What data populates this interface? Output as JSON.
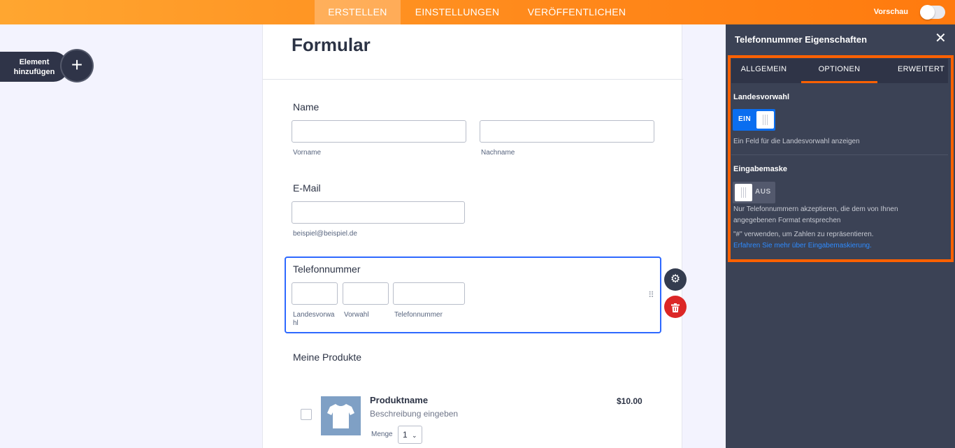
{
  "topbar": {
    "tabs": [
      {
        "label": "ERSTELLEN",
        "active": true
      },
      {
        "label": "EINSTELLUNGEN",
        "active": false
      },
      {
        "label": "VERÖFFENTLICHEN",
        "active": false
      }
    ],
    "preview_label": "Vorschau",
    "preview_on": false
  },
  "add_element": {
    "label_line1": "Element",
    "label_line2": "hinzufügen",
    "icon": "plus-icon"
  },
  "form": {
    "title": "Formular",
    "name": {
      "label": "Name",
      "first_sub": "Vorname",
      "last_sub": "Nachname",
      "first_value": "",
      "last_value": ""
    },
    "email": {
      "label": "E-Mail",
      "sub": "beispiel@beispiel.de",
      "value": ""
    },
    "phone": {
      "label": "Telefonnummer",
      "country_sub": "Landesvorwa hl",
      "area_sub": "Vorwahl",
      "number_sub": "Telefonnummer"
    },
    "products": {
      "title": "Meine Produkte",
      "items": [
        {
          "name": "Produktname",
          "description": "Beschreibung eingeben",
          "price": "$10.00",
          "qty_label": "Menge",
          "qty_value": "1"
        }
      ]
    }
  },
  "panel": {
    "title": "Telefonnummer Eigenschaften",
    "tabs": [
      {
        "label": "ALLGEMEIN",
        "active": false
      },
      {
        "label": "OPTIONEN",
        "active": true
      },
      {
        "label": "ERWEITERT",
        "active": false
      }
    ],
    "country_code": {
      "label": "Landesvorwahl",
      "toggle": "EIN",
      "on": true,
      "description": "Ein Feld für die Landesvorwahl anzeigen"
    },
    "input_mask": {
      "label": "Eingabemaske",
      "toggle": "AUS",
      "on": false,
      "description": "Nur Telefonnummern akzeptieren, die dem von Ihnen angegebenen Format entsprechen",
      "hint": "\"#\" verwenden, um Zahlen zu repräsentieren.",
      "link": "Erfahren Sie mehr über Eingabemaskierung."
    }
  },
  "colors": {
    "accent_orange": "#ff7a0e",
    "highlight": "#ff6100",
    "panel_bg": "#3b4255",
    "selected_field": "#2e69ff",
    "delete": "#dc2626",
    "toggle_on": "#0a6ef0"
  }
}
